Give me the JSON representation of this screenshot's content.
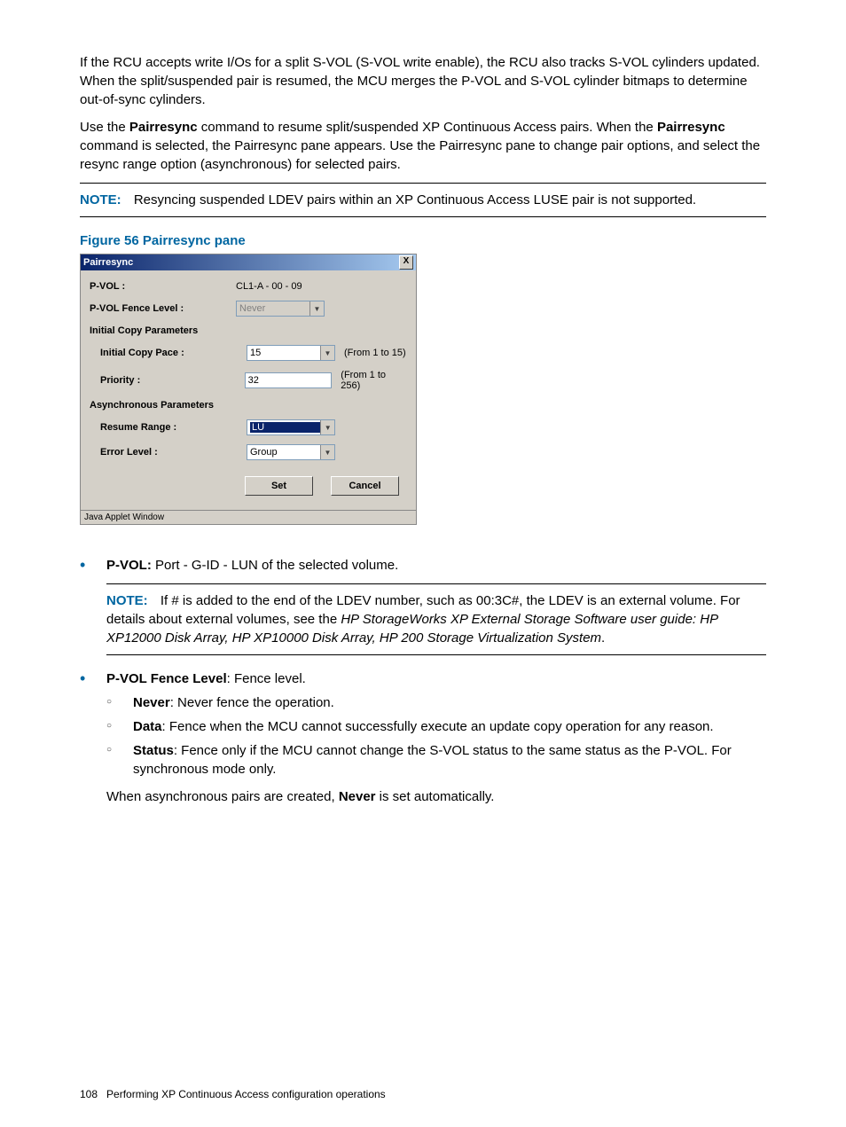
{
  "para1": "If the RCU accepts write I/Os for a split S-VOL (S-VOL write enable), the RCU also tracks S-VOL cylinders updated. When the split/suspended pair is resumed, the MCU merges the P-VOL and S-VOL cylinder bitmaps to determine out-of-sync cylinders.",
  "para2a": "Use the ",
  "para2b": " command to resume split/suspended XP Continuous Access pairs. When the ",
  "para2c": " command is selected, the Pairresync pane appears. Use the Pairresync pane to change pair options, and select the resync range option (asynchronous) for selected pairs.",
  "cmd_pairresync": "Pairresync",
  "note1_label": "NOTE:",
  "note1_text": "Resyncing suspended LDEV pairs within an XP Continuous Access LUSE pair is not supported.",
  "figure_caption": "Figure 56 Pairresync pane",
  "pane": {
    "title": "Pairresync",
    "close": "X",
    "pvol_label": "P-VOL :",
    "pvol_value": "CL1-A - 00 - 09",
    "fence_label": "P-VOL Fence Level :",
    "fence_value": "Never",
    "section_icp": "Initial Copy Parameters",
    "icp_pace_label": "Initial Copy Pace :",
    "icp_pace_value": "15",
    "icp_pace_hint": "(From 1 to 15)",
    "priority_label": "Priority :",
    "priority_value": "32",
    "priority_hint": "(From 1 to 256)",
    "section_async": "Asynchronous Parameters",
    "resume_label": "Resume Range :",
    "resume_value": "LU",
    "err_label": "Error Level :",
    "err_value": "Group",
    "btn_set": "Set",
    "btn_cancel": "Cancel",
    "status": "Java Applet Window"
  },
  "b1_strong": "P-VOL:",
  "b1_text": " Port - G-ID - LUN of the selected volume.",
  "note2_label": "NOTE:",
  "note2_text_a": "If # is added to the end of the LDEV number, such as 00:3C#, the LDEV is an external volume. For details about external volumes, see the ",
  "note2_text_italic": "HP StorageWorks XP External Storage Software user guide: HP XP12000 Disk Array, HP XP10000 Disk Array, HP 200 Storage Virtualization System",
  "note2_text_b": ".",
  "b2_strong": "P-VOL Fence Level",
  "b2_text": ": Fence level.",
  "b2_sub": [
    {
      "strong": "Never",
      "text": ": Never fence the operation."
    },
    {
      "strong": "Data",
      "text": ": Fence when the MCU cannot successfully execute an update copy operation for any reason."
    },
    {
      "strong": "Status",
      "text": ": Fence only if the MCU cannot change the S-VOL status to the same status as the P-VOL. For synchronous mode only."
    }
  ],
  "b2_tail_a": "When asynchronous pairs are created, ",
  "b2_tail_strong": "Never",
  "b2_tail_b": " is set automatically.",
  "footer_page": "108",
  "footer_text": "Performing XP Continuous Access configuration operations"
}
